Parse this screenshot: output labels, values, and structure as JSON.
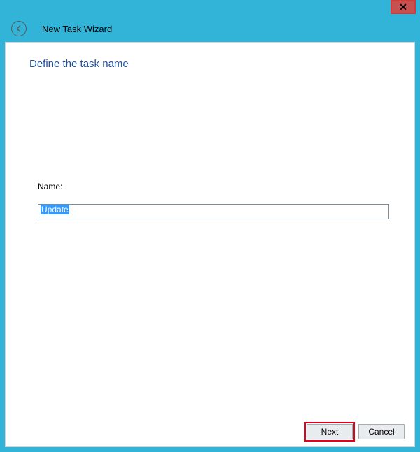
{
  "window": {
    "title": "New Task Wizard",
    "close_symbol": "✕"
  },
  "page": {
    "heading": "Define the task name"
  },
  "form": {
    "name_label": "Name:",
    "name_value": "Update"
  },
  "buttons": {
    "next": "Next",
    "cancel": "Cancel"
  }
}
